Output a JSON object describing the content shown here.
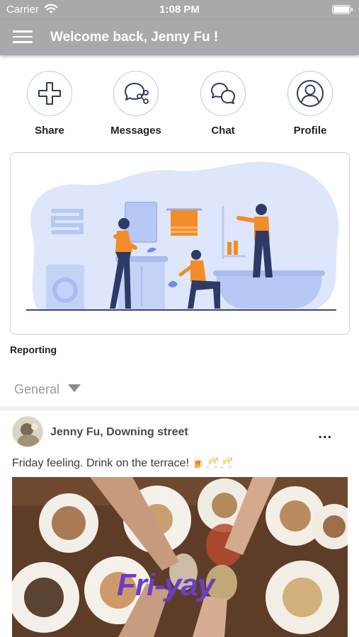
{
  "status_bar": {
    "carrier": "Carrier",
    "time": "1:08 PM"
  },
  "nav": {
    "title": "Welcome back, Jenny Fu !"
  },
  "actions": [
    {
      "label": "Share",
      "icon": "plus-icon"
    },
    {
      "label": "Messages",
      "icon": "share-bubble-icon"
    },
    {
      "label": "Chat",
      "icon": "chat-bubbles-icon"
    },
    {
      "label": "Profile",
      "icon": "person-icon"
    }
  ],
  "banner": {
    "caption": "Reporting"
  },
  "section": {
    "selected": "General"
  },
  "post": {
    "author": "Jenny Fu, Downing street",
    "more": "...",
    "text": "Friday feeling. Drink on the terrace!",
    "emojis": "🍺🥂🥂",
    "image_text": "Fri-yay"
  },
  "colors": {
    "header_bg": "#a8a8ad",
    "icon_stroke": "#2e3a5c",
    "illustration_accent": "#f28c28",
    "illustration_bg": "#dde6fb",
    "image_text": "#6a3fc4"
  }
}
